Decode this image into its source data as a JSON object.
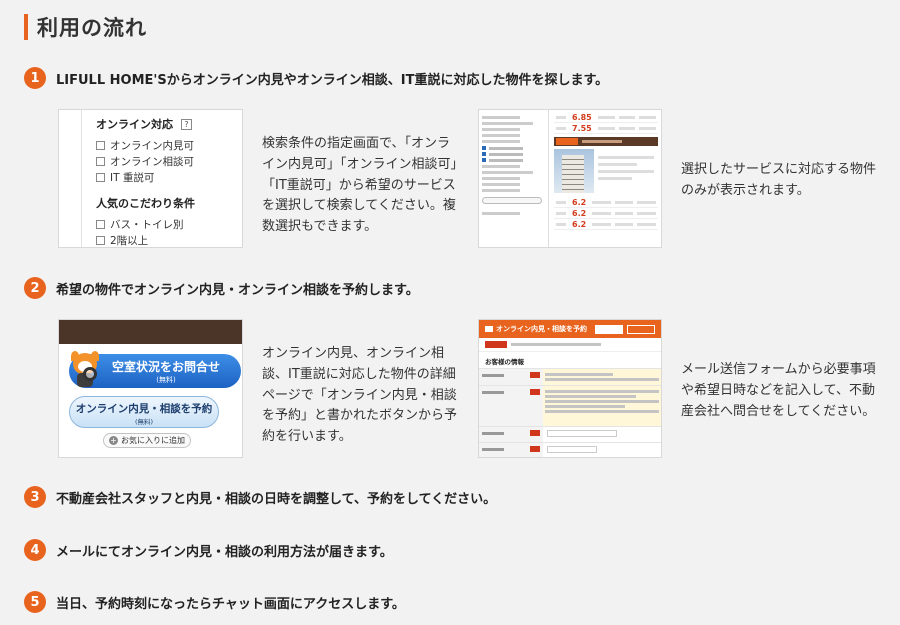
{
  "page_title": "利用の流れ",
  "steps": [
    {
      "num": "1",
      "text": "LIFULL HOME'Sからオンライン内見やオンライン相談、IT重説に対応した物件を探します。"
    },
    {
      "num": "2",
      "text": "希望の物件でオンライン内見・オンライン相談を予約します。"
    },
    {
      "num": "3",
      "text": "不動産会社スタッフと内見・相談の日時を調整して、予約をしてください。"
    },
    {
      "num": "4",
      "text": "メールにてオンライン内見・相談の利用方法が届きます。"
    },
    {
      "num": "5",
      "text": "当日、予約時刻になったらチャット画面にアクセスします。"
    }
  ],
  "step1": {
    "desc_left": "検索条件の指定画面で、「オンライン内見可」「オンライン相談可」「IT重説可」から希望のサービスを選択して検索してください。複数選択もできます。",
    "desc_right": "選択したサービスに対応する物件のみが表示されます。",
    "filter_panel": {
      "online_title": "オンライン対応",
      "help_icon": "?",
      "online_options": [
        "オンライン内見可",
        "オンライン相談可",
        "IT 重説可"
      ],
      "kodawari_title": "人気のこだわり条件",
      "kodawari_options": [
        "バス・トイレ別",
        "2階以上"
      ]
    },
    "result_panel": {
      "prices": [
        "6.85",
        "7.55",
        "6.2",
        "6.2",
        "6.2"
      ],
      "price_unit": "万円"
    }
  },
  "step2": {
    "desc_left": "オンライン内見、オンライン相談、IT重説に対応した物件の詳細ページで「オンライン内見・相談を予約」と書かれたボタンから予約を行います。",
    "desc_right": "メール送信フォームから必要事項や希望日時などを記入して、不動産会社へ問合せをしてください。",
    "buttons": {
      "vacancy_label": "空室状況をお問合せ",
      "vacancy_sub": "(無料)",
      "reserve_label": "オンライン内見・相談を予約",
      "reserve_sub": "(無料)",
      "fav_label": "お気に入りに追加",
      "fav_icon": "+"
    },
    "form_panel": {
      "header": "オンライン内見・相談を予約",
      "section": "お客様の情報"
    }
  },
  "colors": {
    "accent": "#e8641e",
    "background": "#f2f2f2"
  }
}
